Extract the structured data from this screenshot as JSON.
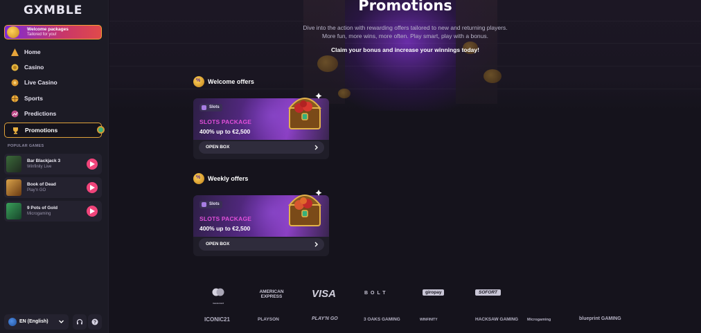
{
  "brand": {
    "logo_text": "GXMBLE"
  },
  "welcome_banner": {
    "title": "Welcome packages",
    "subtitle": "Tailored for you!"
  },
  "nav": [
    {
      "label": "Home",
      "icon": "pyramid-icon"
    },
    {
      "label": "Casino",
      "icon": "coins-icon"
    },
    {
      "label": "Live Casino",
      "icon": "chips-icon"
    },
    {
      "label": "Sports",
      "icon": "ball-icon"
    },
    {
      "label": "Predictions",
      "icon": "chart-icon"
    },
    {
      "label": "Promotions",
      "icon": "trophy-icon",
      "active": true
    }
  ],
  "popular_games": {
    "heading": "POPULAR GAMES",
    "items": [
      {
        "name": "Bar Blackjack 3",
        "provider": "Winfinity Live"
      },
      {
        "name": "Book of Dead",
        "provider": "Play'n GO"
      },
      {
        "name": "9 Pots of Gold",
        "provider": "Microgaming"
      }
    ]
  },
  "footer_controls": {
    "language": "EN (English)"
  },
  "page": {
    "title": "Promotions",
    "subtitle_line1": "Dive into the action with rewarding offers tailored to new and returning players.",
    "subtitle_line2": "More fun, more wins, more often. Play smart, play with a bonus.",
    "claim": "Claim your bonus and increase your winnings today!"
  },
  "sections": [
    {
      "heading": "Welcome offers",
      "card": {
        "tag": "Slots",
        "title": "SLOTS PACKAGE",
        "amount": "400% up to €2,500",
        "button": "OPEN BOX"
      }
    },
    {
      "heading": "Weekly offers",
      "card": {
        "tag": "Slots",
        "title": "SLOTS PACKAGE",
        "amount": "400% up to €2,500",
        "button": "OPEN BOX"
      }
    }
  ],
  "payments": [
    "mastercard",
    "AMERICAN EXPRESS",
    "VISA",
    "BOLT",
    "giropay",
    "SOFORT"
  ],
  "providers": [
    "ICONIC21",
    "PLAYSON",
    "PLAY'N GO",
    "3 OAKS GAMING",
    "WINFINITY",
    "HACKSAW GAMING",
    "Microgaming",
    "blueprint GAMING"
  ],
  "colors": {
    "accent_gold": "#e0a23a",
    "play_pink": "#f0447a",
    "package_magenta": "#e04fd9",
    "sidebar_bg": "#1c1b25"
  }
}
